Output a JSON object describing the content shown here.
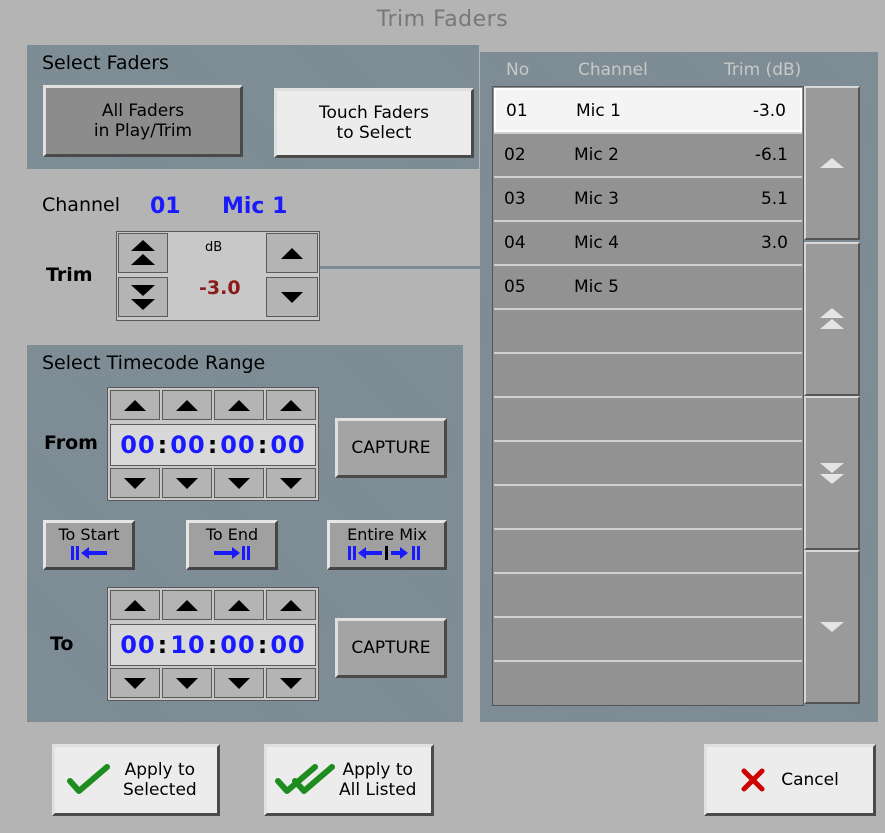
{
  "window": {
    "title": "Trim Faders"
  },
  "select_faders": {
    "title": "Select Faders",
    "all_faders_label": "All Faders\nin Play/Trim",
    "touch_faders_label": "Touch Faders\nto Select"
  },
  "channel": {
    "label": "Channel",
    "number": "01",
    "name": "Mic 1",
    "trim_label": "Trim",
    "trim_unit": "dB",
    "trim_value": "-3.0"
  },
  "timecode": {
    "title": "Select Timecode Range",
    "from_label": "From",
    "to_label": "To",
    "from": [
      "00",
      "00",
      "00",
      "00"
    ],
    "to": [
      "00",
      "10",
      "00",
      "00"
    ],
    "capture_label": "CAPTURE",
    "to_start_label": "To Start",
    "to_end_label": "To End",
    "entire_mix_label": "Entire Mix"
  },
  "table": {
    "headers": [
      "No",
      "Channel",
      "Trim (dB)"
    ],
    "rows": [
      {
        "no": "01",
        "channel": "Mic 1",
        "trim": "-3.0",
        "selected": true
      },
      {
        "no": "02",
        "channel": "Mic 2",
        "trim": "-6.1",
        "selected": false
      },
      {
        "no": "03",
        "channel": "Mic 3",
        "trim": "5.1",
        "selected": false
      },
      {
        "no": "04",
        "channel": "Mic 4",
        "trim": "3.0",
        "selected": false
      },
      {
        "no": "05",
        "channel": "Mic 5",
        "trim": "",
        "selected": false
      }
    ],
    "empty_rows": 9
  },
  "footer": {
    "apply_selected_label": "Apply to\nSelected",
    "apply_all_label": "Apply to\nAll Listed",
    "cancel_label": "Cancel"
  },
  "colors": {
    "accent_blue": "#1a1aff",
    "trim_red": "#8b1a1a",
    "check_green": "#1e8c1e",
    "cancel_red": "#cc0000"
  }
}
